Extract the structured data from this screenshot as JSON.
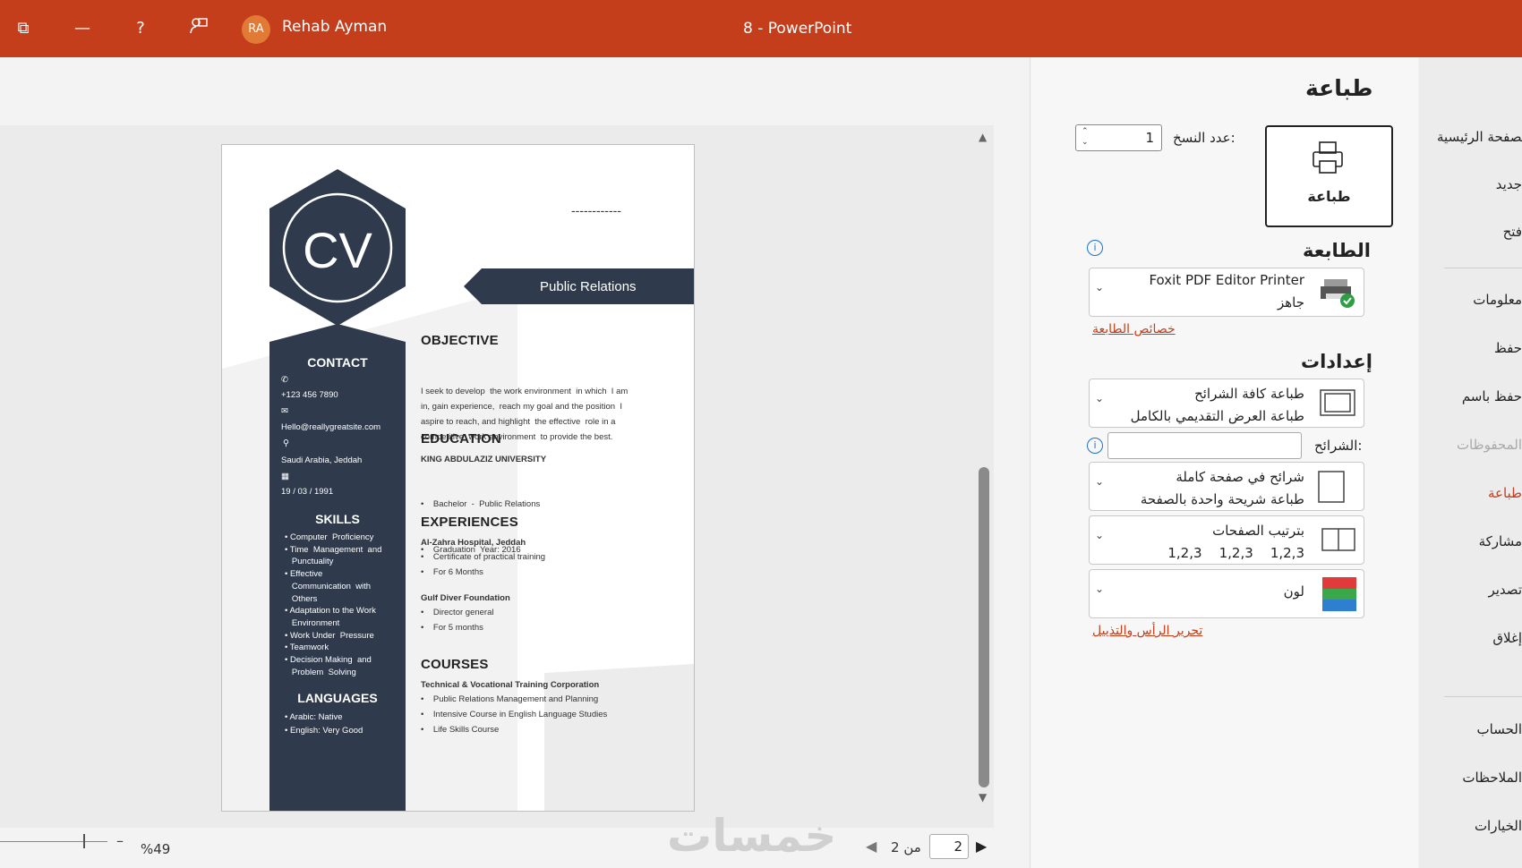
{
  "titlebar": {
    "user_initials": "RA",
    "user_name": "Rehab Ayman",
    "doc_title": "8  -  PowerPoint"
  },
  "print": {
    "page_title": "طباعة",
    "print_button_label": "طباعة",
    "copies_label": "عدد النسخ:",
    "copies_value": "1",
    "printer_section": "الطابعة",
    "printer_name": "Foxit PDF Editor Printer",
    "printer_status": "جاهز",
    "printer_properties_link": "خصائص الطابعة",
    "settings_section": "إعدادات",
    "setting_slides_range": "طباعة كافة الشرائح",
    "setting_slides_range_sub": "طباعة العرض التقديمي بالكامل",
    "slides_label": "الشرائح:",
    "slides_value": "",
    "setting_layout": "شرائح في صفحة كاملة",
    "setting_layout_sub": "طباعة شريحة واحدة بالصفحة",
    "setting_collation": "بترتيب الصفحات",
    "setting_collation_sub": "1,2,3    1,2,3    1,2,3",
    "setting_color": "لون",
    "header_footer_link": "تحرير الرأس والتذييل"
  },
  "nav": {
    "items": [
      "الصفحة الرئيسية",
      "جديد",
      "فتح",
      "معلومات",
      "حفظ",
      "حفظ باسم",
      "المحفوظات",
      "طباعة",
      "مشاركة",
      "تصدير",
      "إغلاق",
      "الحساب",
      "الملاحظات",
      "الخيارات"
    ]
  },
  "footer": {
    "zoom": "%49",
    "page_current": "2",
    "page_of": "من 2",
    "watermark": "خمسات"
  },
  "resume": {
    "monogram": "CV",
    "name_placeholder": "------------",
    "job_title": "Public Relations",
    "contact_heading": "CONTACT",
    "phone": "+123 456 7890",
    "email": "Hello@reallygreatsite.com",
    "location": "Saudi Arabia, Jeddah",
    "birthdate": "19 / 03 / 1991",
    "skills_heading": "SKILLS",
    "skills": [
      "• Computer  Proficiency",
      "• Time  Management  and",
      "   Punctuality",
      "• Effective",
      "   Communication  with",
      "   Others",
      "• Adaptation to the Work",
      "   Environment",
      "• Work Under  Pressure",
      "• Teamwork",
      "• Decision Making  and",
      "   Problem  Solving"
    ],
    "languages_heading": "LANGUAGES",
    "languages": [
      "• Arabic: Native",
      "• English:  Very Good"
    ],
    "objective_heading": "OBJECTIVE",
    "objective_lines": [
      "I seek to develop  the work environment  in which  I am",
      "in, gain experience,  reach my goal and the position  I",
      "aspire to reach, and highlight  the effective  role in a",
      "competitive  work environment  to provide the best."
    ],
    "education_heading": "EDUCATION",
    "education_school": "KING  ABDULAZIZ  UNIVERSITY",
    "education_items": [
      "Bachelor  -  Public Relations",
      "Graduation  Year: 2016"
    ],
    "experiences_heading": "EXPERIENCES",
    "exp1_title": "Al-Zahra  Hospital,  Jeddah",
    "exp1_items": [
      "Certificate  of practical training",
      "For 6 Months"
    ],
    "exp2_title": "Gulf  Diver Foundation",
    "exp2_items": [
      "Director general",
      "For 5 months"
    ],
    "courses_heading": "COURSES",
    "courses_org": "Technical  & Vocational  Training Corporation",
    "courses_items": [
      "Public  Relations  Management  and Planning",
      "Intensive Course  in English  Language  Studies",
      "Life Skills Course"
    ]
  },
  "colors": {
    "titlebar": "#c43e1c",
    "resume_dark": "#2f3b4d",
    "link": "#c43e1c"
  }
}
